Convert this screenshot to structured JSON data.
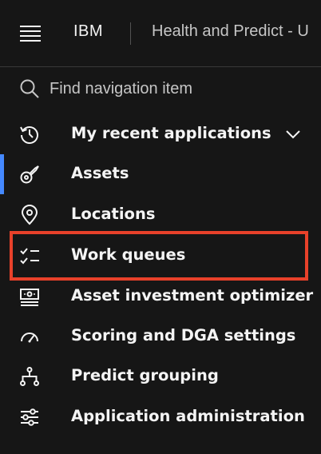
{
  "header": {
    "brand": "IBM",
    "app_name": "Health and Predict - U"
  },
  "search": {
    "placeholder": "Find navigation item"
  },
  "nav": {
    "items": [
      {
        "label": "My recent applications",
        "icon": "recent-history-icon",
        "expandable": true
      },
      {
        "label": "Assets",
        "icon": "assets-icon",
        "active": true
      },
      {
        "label": "Locations",
        "icon": "location-pin-icon"
      },
      {
        "label": "Work queues",
        "icon": "checklist-icon",
        "highlighted": true
      },
      {
        "label": "Asset investment optimizer",
        "icon": "investment-optimizer-icon"
      },
      {
        "label": "Scoring and DGA settings",
        "icon": "meter-icon"
      },
      {
        "label": "Predict grouping",
        "icon": "hierarchy-icon"
      },
      {
        "label": "Application administration",
        "icon": "settings-sliders-icon"
      }
    ]
  },
  "colors": {
    "background": "#161616",
    "text": "#f4f4f4",
    "active_indicator": "#4589ff",
    "highlight": "#e8412a"
  }
}
